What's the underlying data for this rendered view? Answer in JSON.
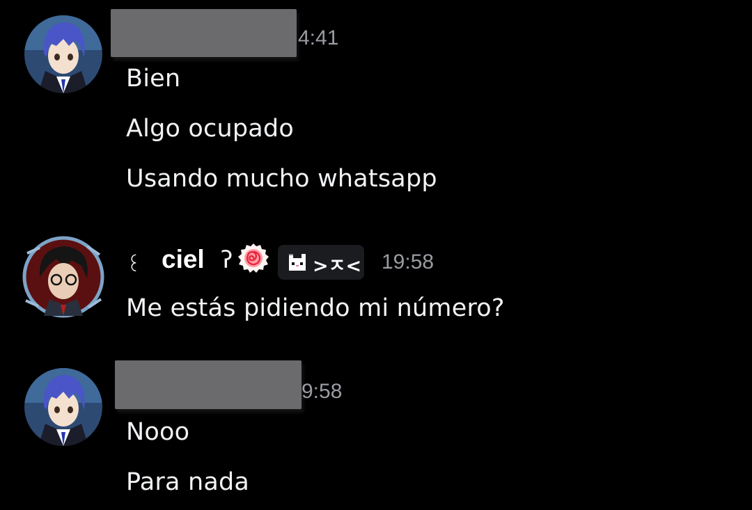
{
  "messages": [
    {
      "author": "",
      "timestamp_visible": "4:41",
      "lines": [
        "Bien",
        "Algo ocupado",
        "Usando mucho whatsapp"
      ]
    },
    {
      "author": "ciel",
      "author_decor_prefix": "꒰",
      "author_decor_suffix": "ʔ",
      "tag": ">ㅈ<",
      "timestamp": "19:58",
      "lines": [
        "Me estás pidiendo mi número?"
      ]
    },
    {
      "author": "",
      "timestamp_visible": "9:58",
      "lines": [
        "Nooo",
        "Para nada"
      ]
    }
  ],
  "colors": {
    "background": "#000000",
    "text": "#f2f3f5",
    "timestamp": "#9a9ca2",
    "redaction": "#6b6b6d",
    "badge": "#1b1c1f"
  },
  "icons": {
    "avatar_1": "anime-avatar-blue-hair",
    "avatar_2": "anime-avatar-glasses",
    "emoji": "naruto-candy-icon",
    "tag_icon": "pixel-cat-icon"
  }
}
